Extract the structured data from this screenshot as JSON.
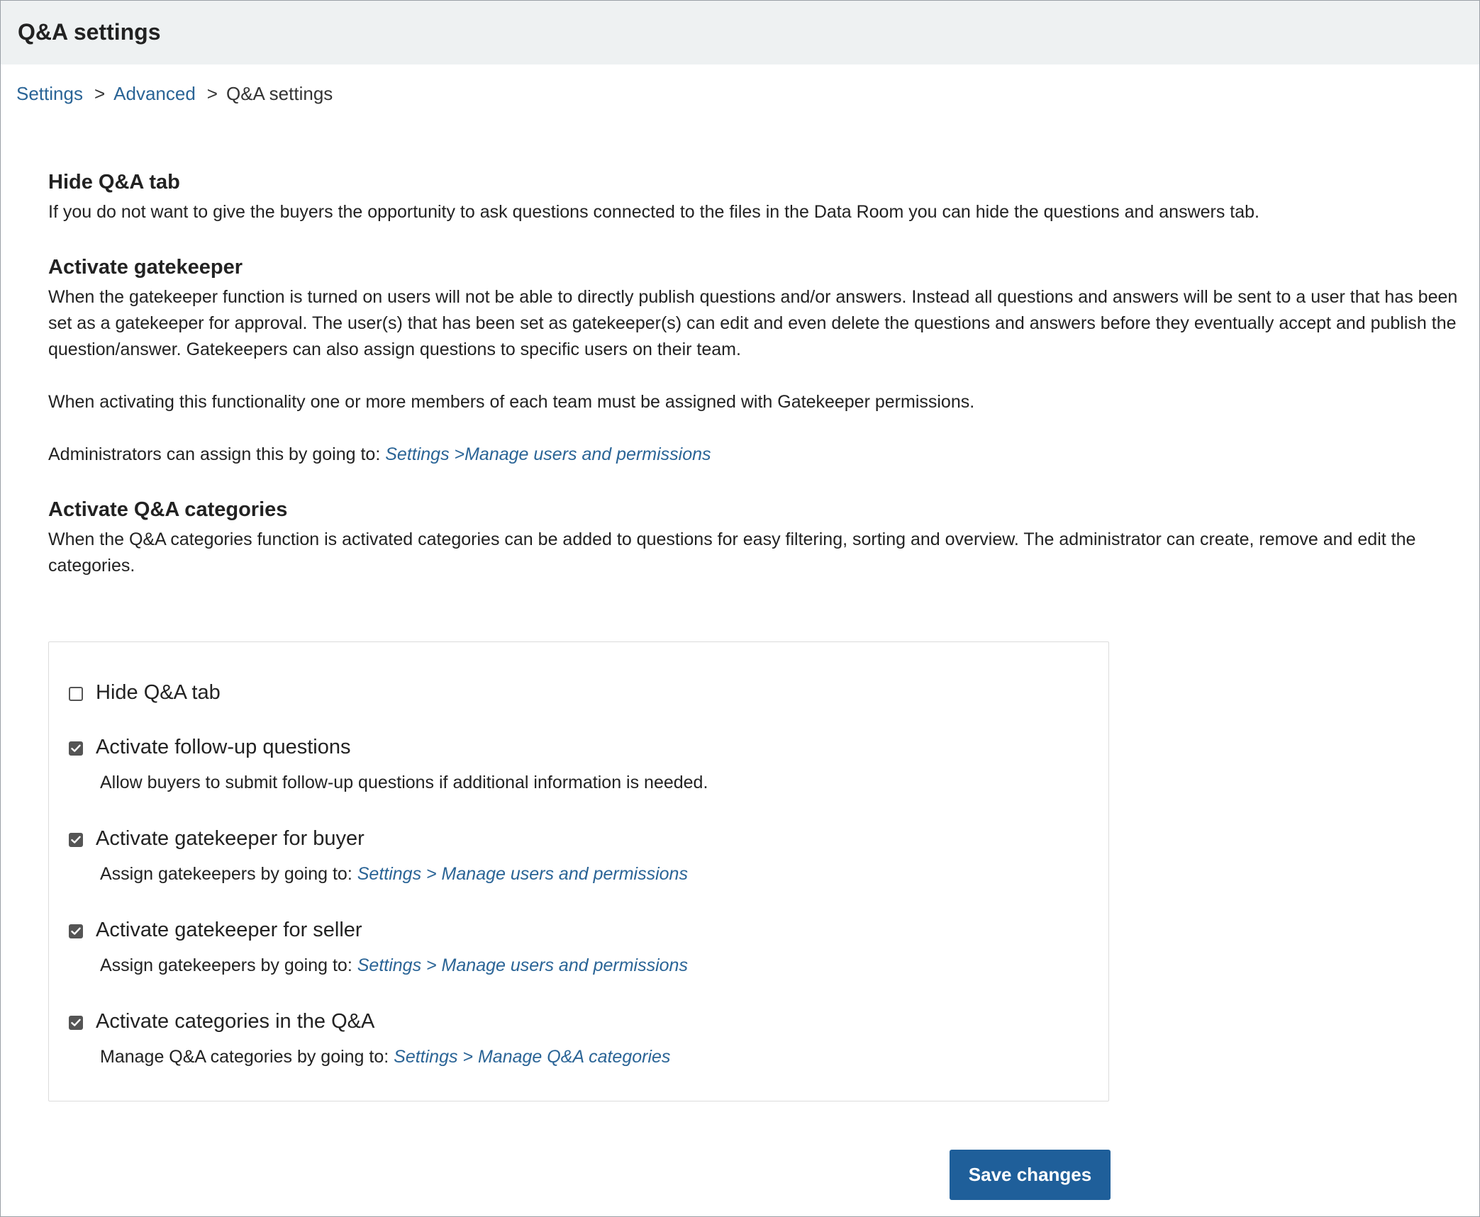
{
  "header": {
    "title": "Q&A settings"
  },
  "breadcrumb": {
    "items": [
      {
        "label": "Settings"
      },
      {
        "label": "Advanced"
      }
    ],
    "separator": ">",
    "current": "Q&A settings"
  },
  "sections": {
    "hide_tab": {
      "title": "Hide Q&A tab",
      "text": "If you do not want to give the buyers the opportunity to ask questions connected to the files in the Data Room you can hide the questions and answers tab."
    },
    "gatekeeper": {
      "title": "Activate gatekeeper",
      "paragraph1": "When the gatekeeper function is turned on users will not be able to directly publish questions and/or answers. Instead all questions and answers will be sent to a user that has been set as a gatekeeper for approval. The user(s) that has been set as gatekeeper(s) can edit and even delete the questions and answers before they eventually accept and publish the question/answer. Gatekeepers can also assign questions to specific users on their team.",
      "paragraph2": "When activating this functionality one or more members of each team must be assigned with Gatekeeper permissions.",
      "paragraph3_prefix": "Administrators can assign this by going to: ",
      "paragraph3_link": "Settings >Manage users and permissions"
    },
    "categories": {
      "title": "Activate Q&A categories",
      "text": "When the Q&A categories function is activated categories can be added to questions for easy filtering, sorting and overview. The administrator can create, remove and edit the categories."
    }
  },
  "options": [
    {
      "label": "Hide Q&A tab",
      "checked": false
    },
    {
      "label": "Activate follow-up questions",
      "checked": true,
      "description": "Allow buyers to submit follow-up questions if additional information is needed."
    },
    {
      "label": "Activate gatekeeper for buyer",
      "checked": true,
      "description_prefix": "Assign gatekeepers by going to: ",
      "description_link": "Settings > Manage users and permissions"
    },
    {
      "label": "Activate gatekeeper for seller",
      "checked": true,
      "description_prefix": "Assign gatekeepers by going to: ",
      "description_link": "Settings > Manage users and permissions"
    },
    {
      "label": "Activate categories in the Q&A",
      "checked": true,
      "description_prefix": "Manage Q&A categories by going to: ",
      "description_link": "Settings > Manage Q&A categories"
    }
  ],
  "actions": {
    "save_label": "Save changes"
  },
  "colors": {
    "link": "#2a6496",
    "primary_button": "#1f5f9a",
    "header_bg": "#eef1f2",
    "checkbox_checked": "#555555"
  },
  "icons": {
    "checkmark": "checkmark-icon"
  }
}
